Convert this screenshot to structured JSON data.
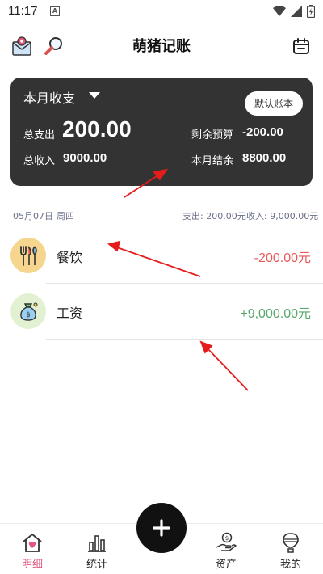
{
  "status_bar": {
    "time": "11:17",
    "notif_letter": "A"
  },
  "header": {
    "title": "萌猪记账",
    "left_icons": [
      "mail-location-icon",
      "search-icon"
    ],
    "right_icon": "calendar-icon"
  },
  "summary": {
    "period_label": "本月收支",
    "book_button": "默认账本",
    "expense_label": "总支出",
    "expense_value": "200.00",
    "income_label": "总收入",
    "income_value": "9000.00",
    "budget_label": "剩余预算",
    "budget_value": "-200.00",
    "balance_label": "本月结余",
    "balance_value": "8800.00"
  },
  "day": {
    "date": "05月07日",
    "weekday": "周四",
    "expense": "支出: 200.00元",
    "income": "收入: 9,000.00元"
  },
  "transactions": [
    {
      "name": "餐饮",
      "amount": "-200.00元",
      "color": "#e85a5a",
      "icon": "fork-knife-icon",
      "icon_bg": "#f6d58e"
    },
    {
      "name": "工资",
      "amount": "+9,000.00元",
      "color": "#57a86b",
      "icon": "money-bag-icon",
      "icon_bg": "#e3f1d3"
    }
  ],
  "nav": {
    "items": [
      {
        "label": "明细",
        "active": true
      },
      {
        "label": "统计",
        "active": false
      },
      {
        "label": "资产",
        "active": false
      },
      {
        "label": "我的",
        "active": false
      }
    ],
    "active_color": "#e0577d"
  }
}
